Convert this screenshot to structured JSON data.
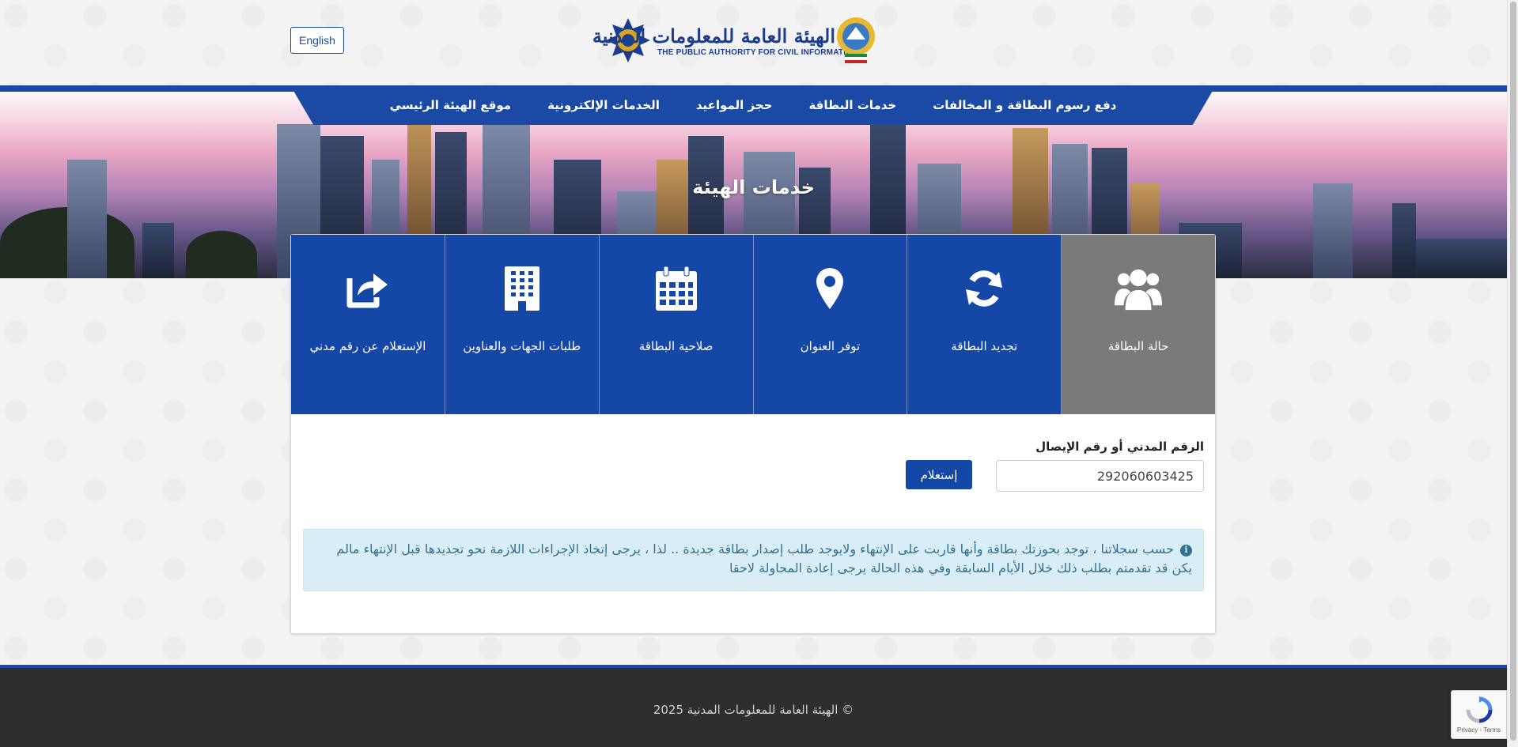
{
  "header": {
    "language_button": "English",
    "logo_arabic": "الهيئة العامة للمعلومات المدنية",
    "logo_english": "THE PUBLIC AUTHORITY FOR CIVIL INFORMATION"
  },
  "nav": {
    "items": [
      {
        "label": "موقع الهيئة الرئيسي"
      },
      {
        "label": "الخدمات الإلكترونية"
      },
      {
        "label": "حجز المواعيد"
      },
      {
        "label": "خدمات البطاقة"
      },
      {
        "label": "دفع رسوم البطاقة و المخالفات"
      }
    ]
  },
  "hero": {
    "title": "خدمات الهيئة"
  },
  "tiles": [
    {
      "label": "حالة البطاقة",
      "icon": "users-icon",
      "active": true
    },
    {
      "label": "تجديد البطاقة",
      "icon": "refresh-icon",
      "active": false
    },
    {
      "label": "توفر العنوان",
      "icon": "map-marker-icon",
      "active": false
    },
    {
      "label": "صلاحية البطاقة",
      "icon": "calendar-icon",
      "active": false
    },
    {
      "label": "طلبات الجهات والعناوين",
      "icon": "building-icon",
      "active": false
    },
    {
      "label": "الإستعلام عن رقم مدني",
      "icon": "share-icon",
      "active": false
    }
  ],
  "form": {
    "label": "الرقم المدني أو رقم الإيصال",
    "input_value": "292060603425",
    "submit_label": "إستعلام"
  },
  "alert": {
    "text": "حسب سجلاتنا ، توجد بحوزتك بطاقة وأنها قاربت على الإنتهاء ولايوجد طلب إصدار بطاقة جديدة .. لذا ، يرجى إتخاذ الإجراءات اللازمة نحو تجديدها قبل الإنتهاء مالم يكن قد تقدمتم بطلب ذلك خلال الأيام السابقة وفي هذه الحالة يرجى إعادة المحاولة لاحقا"
  },
  "footer": {
    "copyright": "© الهيئة العامة للمعلومات المدنية 2025"
  },
  "recaptcha": {
    "terms": "Privacy - Terms"
  },
  "colors": {
    "primary": "#1447a6",
    "active_tile": "#7a7a7a",
    "alert_bg": "#d9edf7",
    "footer_bg": "#2e2e2e"
  }
}
